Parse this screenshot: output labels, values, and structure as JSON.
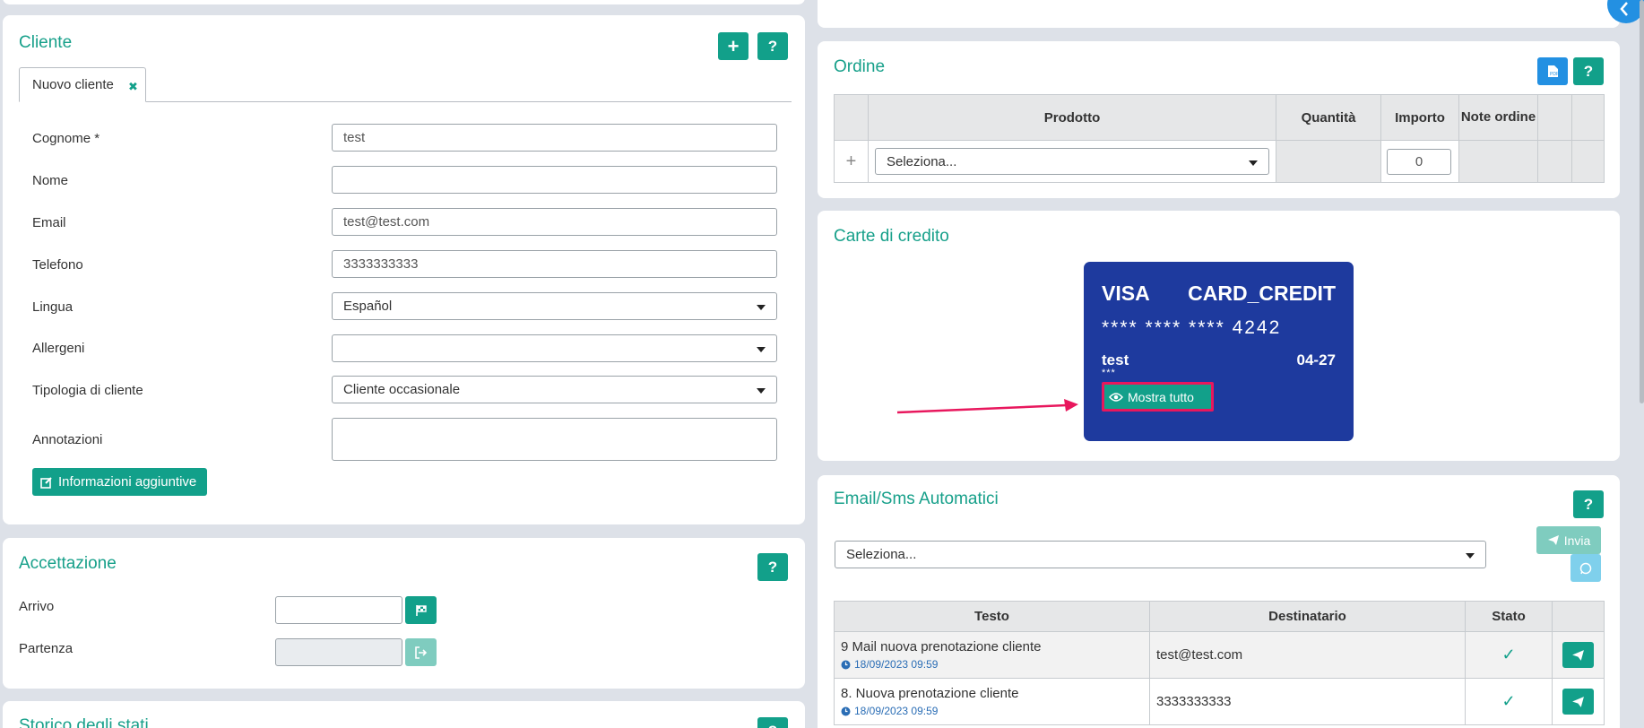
{
  "cliente": {
    "title": "Cliente",
    "add_label": "+",
    "help_label": "?",
    "tab_label": "Nuovo cliente",
    "tab_close": "✖",
    "fields": [
      {
        "label": "Cognome",
        "required": "*",
        "value": "test"
      },
      {
        "label": "Nome",
        "value": ""
      },
      {
        "label": "Email",
        "value": "test@test.com"
      },
      {
        "label": "Telefono",
        "value": "3333333333"
      },
      {
        "label": "Lingua",
        "value": "Español"
      },
      {
        "label": "Allergeni",
        "value": ""
      },
      {
        "label": "Tipologia di cliente",
        "value": "Cliente occasionale"
      },
      {
        "label": "Annotazioni",
        "value": ""
      }
    ],
    "info_button": "Informazioni aggiuntive"
  },
  "accettazione": {
    "title": "Accettazione",
    "help_label": "?",
    "arrivo_label": "Arrivo",
    "partenza_label": "Partenza",
    "arrivo_value": "",
    "partenza_value": ""
  },
  "storico": {
    "title": "Storico degli stati",
    "help_label": "?"
  },
  "ordine": {
    "title": "Ordine",
    "help_label": "?",
    "headers": [
      "Prodotto",
      "Quantità",
      "Importo",
      "Note ordine"
    ],
    "add_row": "+",
    "product_select": "Seleziona...",
    "importo_value": "0"
  },
  "carte": {
    "title": "Carte di credito",
    "brand": "VISA",
    "type": "CARD_CREDIT",
    "number": "**** **** **** 4242",
    "holder": "test",
    "expiry": "04-27",
    "cvv": "***",
    "show_all": "Mostra tutto"
  },
  "emailsms": {
    "title": "Email/Sms Automatici",
    "help_label": "?",
    "select": "Seleziona...",
    "send_label": "Invia",
    "headers": [
      "Testo",
      "Destinatario",
      "Stato"
    ],
    "rows": [
      {
        "text": "9 Mail nuova prenotazione cliente",
        "date": "18/09/2023 09:59",
        "recipient": "test@test.com",
        "status": "✓"
      },
      {
        "text": "8. Nuova prenotazione cliente",
        "date": "18/09/2023 09:59",
        "recipient": "3333333333",
        "status": "✓"
      }
    ]
  },
  "colors": {
    "accent": "#12a08a",
    "card": "#1e3a9e",
    "highlight": "#e8175d",
    "blue": "#2390e2"
  }
}
